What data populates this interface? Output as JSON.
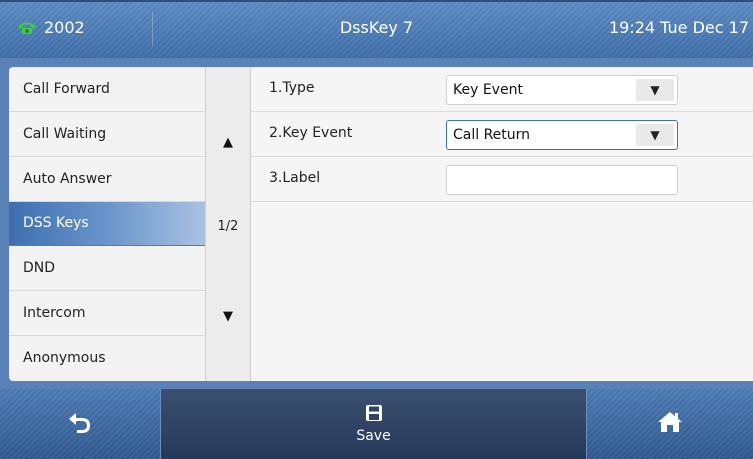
{
  "status": {
    "extension": "2002",
    "title": "DssKey 7",
    "datetime": "19:24 Tue Dec 17"
  },
  "menu": {
    "items": [
      {
        "label": "Call Forward"
      },
      {
        "label": "Call Waiting"
      },
      {
        "label": "Auto Answer"
      },
      {
        "label": "DSS Keys"
      },
      {
        "label": "DND"
      },
      {
        "label": "Intercom"
      },
      {
        "label": "Anonymous"
      }
    ],
    "active_index": 3
  },
  "pager": {
    "page": "1/2",
    "up_symbol": "▲",
    "down_symbol": "▼"
  },
  "form": {
    "type_label": "1.Type",
    "type_value": "Key Event",
    "key_event_label": "2.Key Event",
    "key_event_value": "Call Return",
    "label_label": "3.Label",
    "label_value": "",
    "dropdown_symbol": "▼"
  },
  "softkeys": {
    "back_icon": "back-arrow-icon",
    "save_label": "Save",
    "save_icon": "floppy-disk-icon",
    "home_icon": "home-icon"
  },
  "colors": {
    "accent": "#3d6fb0",
    "bar": "#4d7bb6"
  }
}
